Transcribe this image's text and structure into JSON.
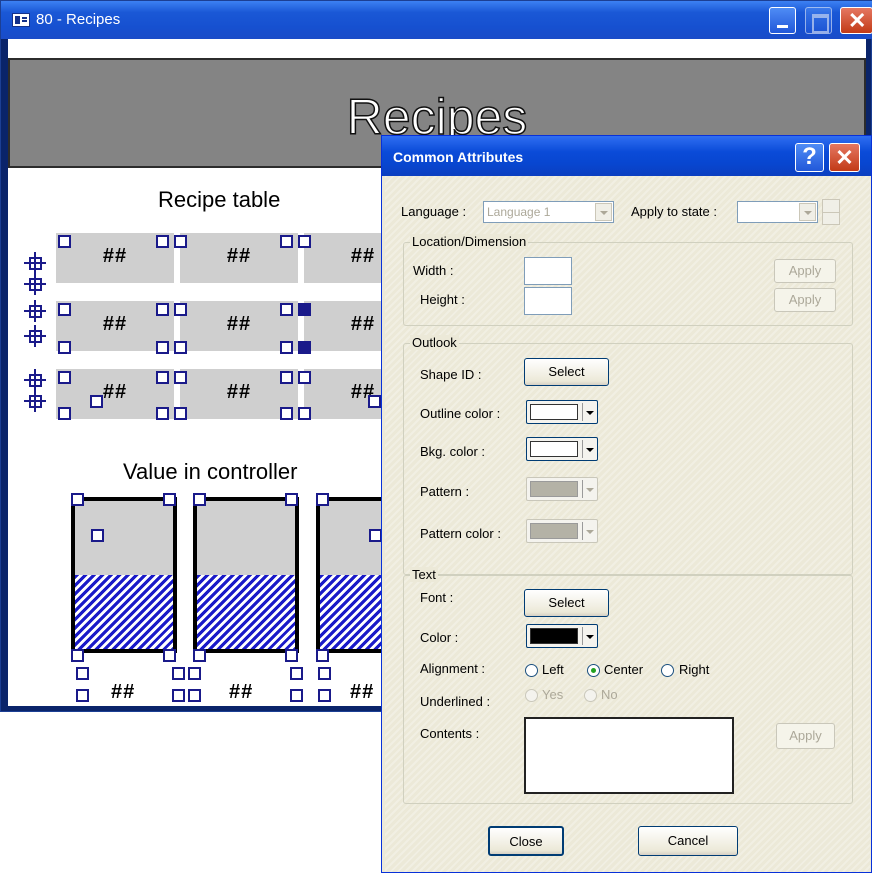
{
  "window": {
    "title": "80 - Recipes",
    "banner_title": "Recipes",
    "recipe_table_title": "Recipe table",
    "controller_title": "Value in controller",
    "placeholder": "##"
  },
  "dialog": {
    "title": "Common Attributes",
    "help_label": "?",
    "language_label": "Language :",
    "language_value": "Language 1",
    "apply_state_label": "Apply to state :",
    "apply_state_value": "",
    "location": {
      "caption": "Location/Dimension",
      "width_label": "Width :",
      "width_value": "",
      "height_label": "Height :",
      "height_value": "",
      "apply_label": "Apply"
    },
    "outlook": {
      "caption": "Outlook",
      "shape_label": "Shape ID :",
      "select_label": "Select",
      "outline_label": "Outline color :",
      "outline_color": "#ffffff",
      "bkg_label": "Bkg. color :",
      "bkg_color": "#ffffff",
      "pattern_label": "Pattern :",
      "pattern_color_label": "Pattern color :",
      "disabled_color": "#b4b2a6"
    },
    "text": {
      "caption": "Text",
      "font_label": "Font :",
      "select_label": "Select",
      "color_label": "Color :",
      "color_value": "#000000",
      "alignment_label": "Alignment :",
      "align_left": "Left",
      "align_center": "Center",
      "align_right": "Right",
      "selected_alignment": "Center",
      "underlined_label": "Underlined :",
      "yes_label": "Yes",
      "no_label": "No",
      "contents_label": "Contents :",
      "contents_value": "",
      "apply_label": "Apply"
    },
    "close_label": "Close",
    "cancel_label": "Cancel"
  }
}
